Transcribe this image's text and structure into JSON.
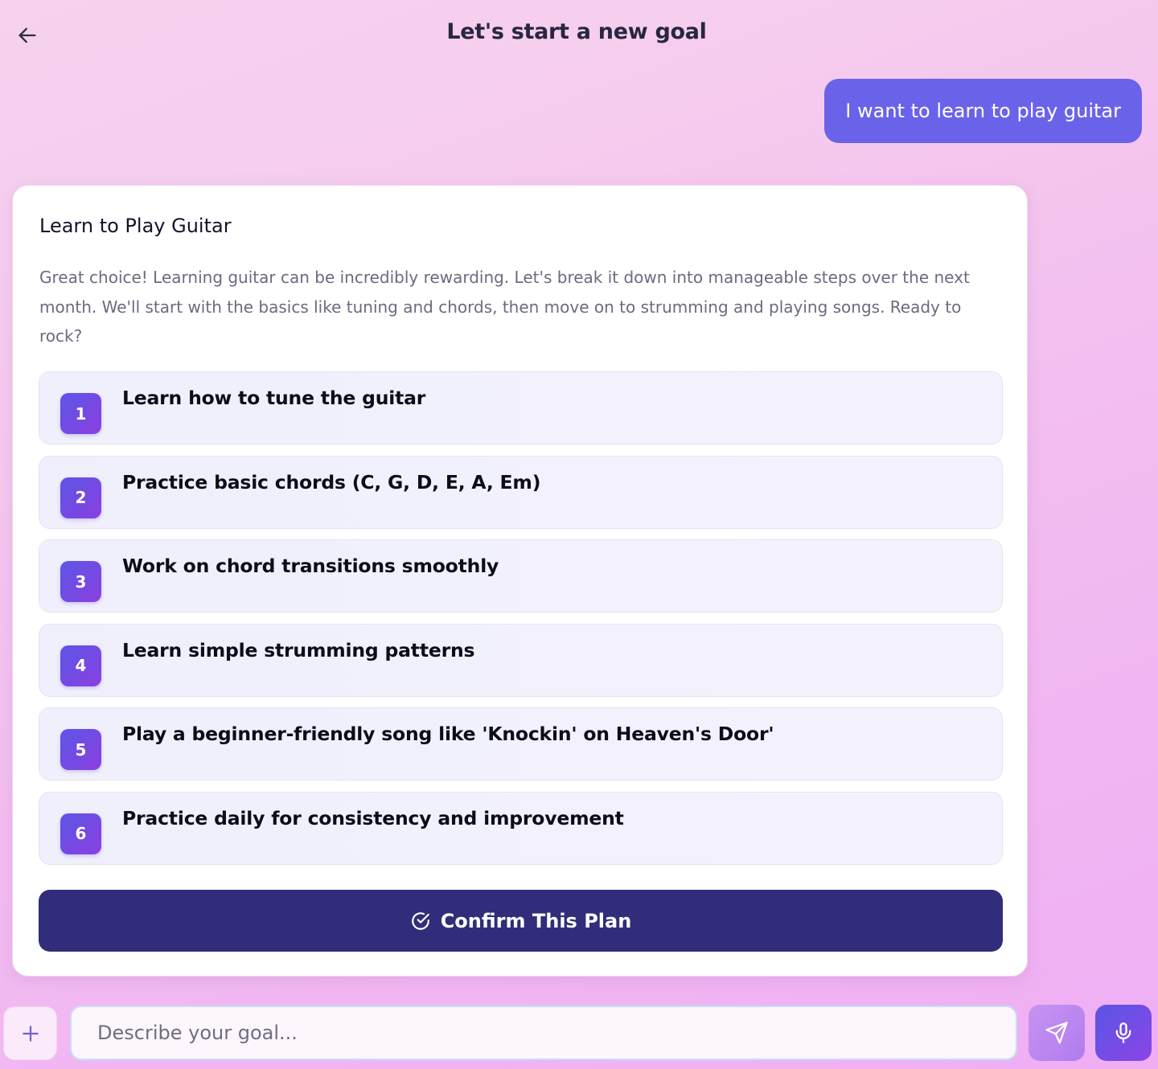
{
  "header": {
    "title": "Let's start a new goal",
    "back_icon": "arrow-left-icon"
  },
  "chat": {
    "user_message": "I want to learn to play guitar"
  },
  "plan": {
    "title": "Learn to Play Guitar",
    "description": "Great choice! Learning guitar can be incredibly rewarding. Let's break it down into manageable steps over the next month. We'll start with the basics like tuning and chords, then move on to strumming and playing songs. Ready to rock?",
    "steps": [
      {
        "number": "1",
        "text": "Learn how to tune the guitar"
      },
      {
        "number": "2",
        "text": "Practice basic chords (C, G, D, E, A, Em)"
      },
      {
        "number": "3",
        "text": "Work on chord transitions smoothly"
      },
      {
        "number": "4",
        "text": "Learn simple strumming patterns"
      },
      {
        "number": "5",
        "text": "Play a beginner-friendly song like 'Knockin' on Heaven's Door'"
      },
      {
        "number": "6",
        "text": "Practice daily for consistency and improvement"
      }
    ],
    "confirm_label": "Confirm This Plan",
    "confirm_icon": "check-circle-icon"
  },
  "composer": {
    "add_icon": "plus-icon",
    "placeholder": "Describe your goal...",
    "value": "",
    "send_icon": "send-icon",
    "mic_icon": "microphone-icon"
  },
  "colors": {
    "accent": "#6a63ea",
    "badge_start": "#5c56e6",
    "badge_end": "#8a3fe0",
    "confirm_bg": "#312d7a",
    "send_bg": "#c793f0"
  }
}
